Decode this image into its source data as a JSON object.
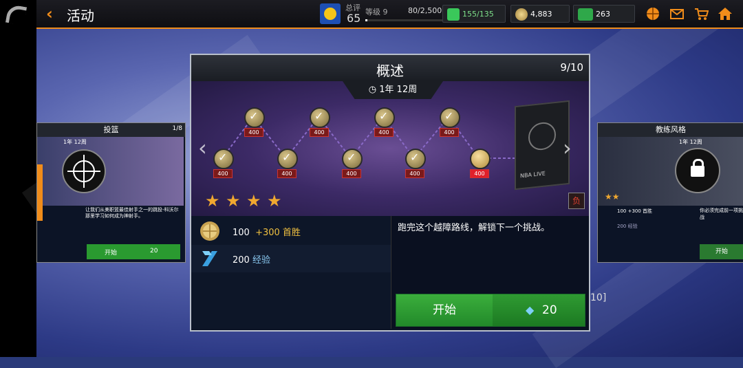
{
  "header": {
    "title": "活动",
    "ovr_label": "总评",
    "ovr": "65",
    "level": "等级 9",
    "xp": "80/2,500",
    "level_progress": 0.02
  },
  "currencies": [
    {
      "name": "energy",
      "value": "155/135",
      "color": "#3ac85a"
    },
    {
      "name": "coins",
      "value": "4,883",
      "color": "#d9b45a"
    },
    {
      "name": "cash",
      "value": "263",
      "color": "#3ac85a"
    }
  ],
  "modal": {
    "title": "概述",
    "page": "9/10",
    "timer": "1年 12周",
    "node_cost": "400",
    "stars": 4,
    "flag": "负",
    "brand": "NBA LIVE",
    "rewards": [
      {
        "amount": "100",
        "bonus": "+300 首胜",
        "icon": "basketball-coin-icon"
      },
      {
        "amount": "200",
        "bonus": "经验",
        "icon": "xp-chevron-icon"
      }
    ],
    "description": "跑完这个越障路线，解锁下一个挑战。",
    "start_label": "开始",
    "start_cost": "20"
  },
  "left_card": {
    "title": "投篮",
    "page": "1/8",
    "timer": "1年 12周",
    "desc": "让我们从美职篮最佳射手之一的跳投-科沃尔那里学习如何成为神射手。",
    "start_label": "开始",
    "cost": "20"
  },
  "right_card": {
    "title": "教练风格",
    "timer": "1年 12周",
    "reward": "100 +300 首胜",
    "xp": "200 经验",
    "desc": "你必须完成前一项挑战",
    "start_label": "开始"
  },
  "bg_fragment": "10]"
}
